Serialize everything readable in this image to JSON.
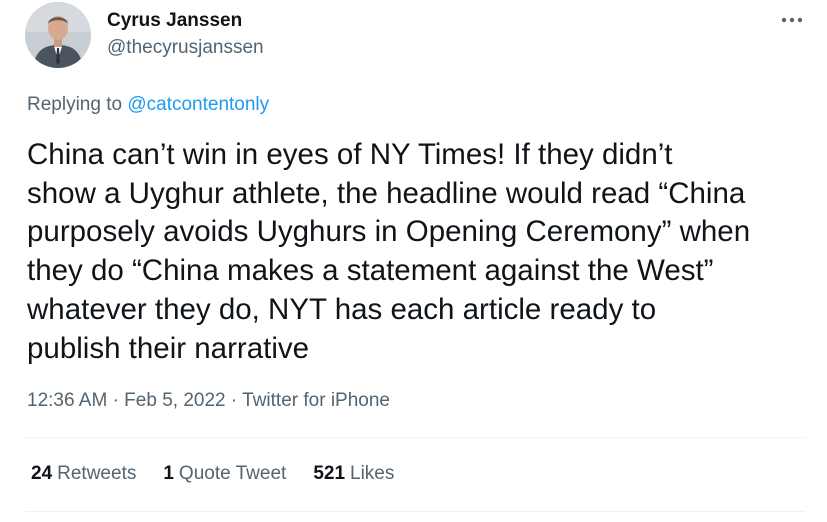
{
  "author": {
    "display_name": "Cyrus Janssen",
    "handle": "@thecyrusjanssen",
    "avatar_icon": "avatar-photo"
  },
  "reply": {
    "prefix": "Replying to",
    "mention": "@catcontentonly"
  },
  "tweet": {
    "text": "China can’t win in eyes of NY Times! If they didn’t\nshow a Uyghur athlete, the headline would read “China\npurposely avoids Uyghurs in Opening Ceremony” when\nthey do “China makes a statement against the West”\nwhatever they do, NYT has each article ready to\npublish their narrative",
    "time": "12:36 AM",
    "separator": "·",
    "date": "Feb 5, 2022",
    "source": "Twitter for iPhone"
  },
  "stats": [
    {
      "count": "24",
      "label": "Retweets"
    },
    {
      "count": "1",
      "label": "Quote Tweet"
    },
    {
      "count": "521",
      "label": "Likes"
    }
  ],
  "more_icon": "more-options-icon",
  "colors": {
    "text": "#0f1419",
    "secondary": "#536471",
    "link": "#1d9bf0",
    "divider": "#eff3f4"
  }
}
